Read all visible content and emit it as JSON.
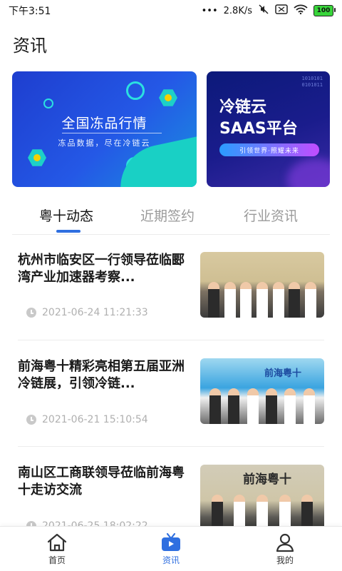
{
  "status_bar": {
    "time": "下午3:51",
    "network_speed": "2.8K/s",
    "battery": "100"
  },
  "page": {
    "title": "资讯"
  },
  "banners": [
    {
      "title": "全国冻品行情",
      "subtitle": "冻品数据，尽在冷链云"
    },
    {
      "title_line1": "冷链云",
      "title_line2": "SAAS平台",
      "pill": "引领世界·照耀未来",
      "binary": "1010101\n0101011"
    }
  ],
  "tabs": [
    {
      "label": "粤十动态",
      "active": true
    },
    {
      "label": "近期签约",
      "active": false
    },
    {
      "label": "行业资讯",
      "active": false
    }
  ],
  "news": [
    {
      "title": "杭州市临安区一行领导莅临郾湾产业加速器考察...",
      "time": "2021-06-24 11:21:33"
    },
    {
      "title": "前海粤十精彩亮相第五届亚洲冷链展，引领冷链...",
      "time": "2021-06-21 15:10:54",
      "image_text": "前海粤十"
    },
    {
      "title": "南山区工商联领导莅临前海粤十走访交流",
      "time": "2021-06-25 18:02:22",
      "image_text": "前海粤十"
    }
  ],
  "bottom_nav": [
    {
      "label": "首页",
      "icon": "home-icon",
      "active": false
    },
    {
      "label": "资讯",
      "icon": "tv-icon",
      "active": true
    },
    {
      "label": "我的",
      "icon": "user-icon",
      "active": false
    }
  ],
  "colors": {
    "accent": "#2f6fe0"
  }
}
